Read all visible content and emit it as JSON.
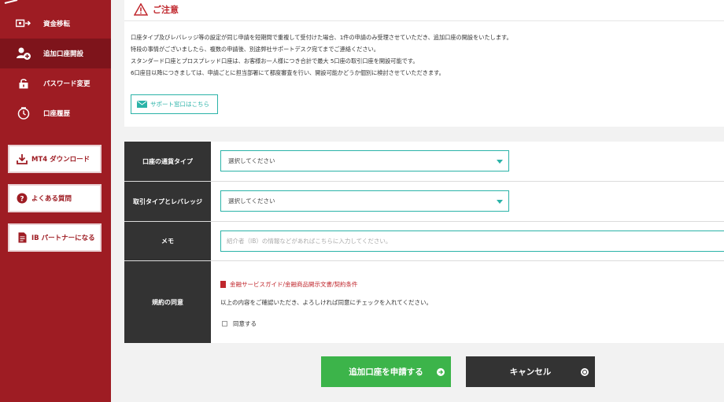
{
  "sidebar": {
    "nav": [
      {
        "label": "資金移転",
        "icon": "money-transfer-icon"
      },
      {
        "label": "追加口座開設",
        "icon": "add-account-icon"
      },
      {
        "label": "パスワード変更",
        "icon": "lock-icon"
      },
      {
        "label": "口座履歴",
        "icon": "clock-icon"
      }
    ],
    "buttons": [
      {
        "label": "MT4 ダウンロード",
        "icon": "download-icon"
      },
      {
        "label": "よくある質問",
        "icon": "question-icon"
      },
      {
        "label": "IB パートナーになる",
        "icon": "document-icon"
      }
    ]
  },
  "notice": {
    "title": "ご注意",
    "lines": [
      "口座タイプ及びレバレッジ等の設定が同じ申請を短期間で重複して受付けた場合、1件の申請のみ受理させていただき、追加口座の開設をいたします。",
      "特段の事情がございましたら、複数の申請後、別途弊社サポートデスク宛てまでご連絡ください。",
      "スタンダード口座とプロスプレッド口座は、お客様お一人様につき合計で最大 5口座の取引口座を開設可能です。",
      "6口座目以降につきましては、申請ごとに担当部署にて都度審査を行い、開設可能かどうか個別に検討させていただきます。"
    ],
    "support_label": "サポート窓口はこちら"
  },
  "form": {
    "currency_label": "口座の通貨タイプ",
    "currency_value": "選択してください",
    "trade_label": "取引タイプとレバレッジ",
    "trade_value": "選択してください",
    "memo_label": "メモ",
    "memo_placeholder": "紹介者（IB）の情報などがあればこちらに入力してください。",
    "terms_label": "規約の同意",
    "terms_link": "金融サービスガイド/金融商品開示文書/契約条件",
    "terms_text": "以上の内容をご確認いただき、よろしければ同意にチェックを入れてください。",
    "agree_label": "同意する"
  },
  "actions": {
    "apply_label": "追加口座を申請する",
    "cancel_label": "キャンセル"
  },
  "colors": {
    "sidebar": "#9e1c23",
    "accent_teal": "#2bb3a8",
    "apply_green": "#3cb44a",
    "dark": "#333333",
    "warning_red": "#c0272d"
  }
}
